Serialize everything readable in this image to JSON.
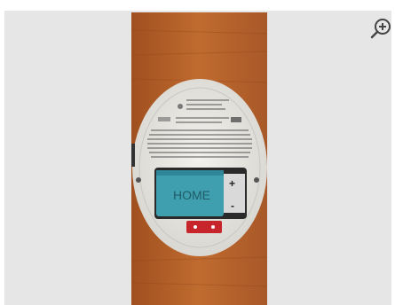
{
  "viewer": {
    "zoom_button_label": "Zoom in",
    "zoom_icon": "zoom-in-icon"
  },
  "photo": {
    "battery_brand_text": "HOME",
    "battery_plus": "+",
    "battery_minus": "-"
  },
  "colors": {
    "viewer_bg": "#e6e6e6",
    "wood": "#b5622a",
    "detector_body": "#ecebe7",
    "battery": "#3f9fae",
    "red_tab": "#c8242c"
  }
}
